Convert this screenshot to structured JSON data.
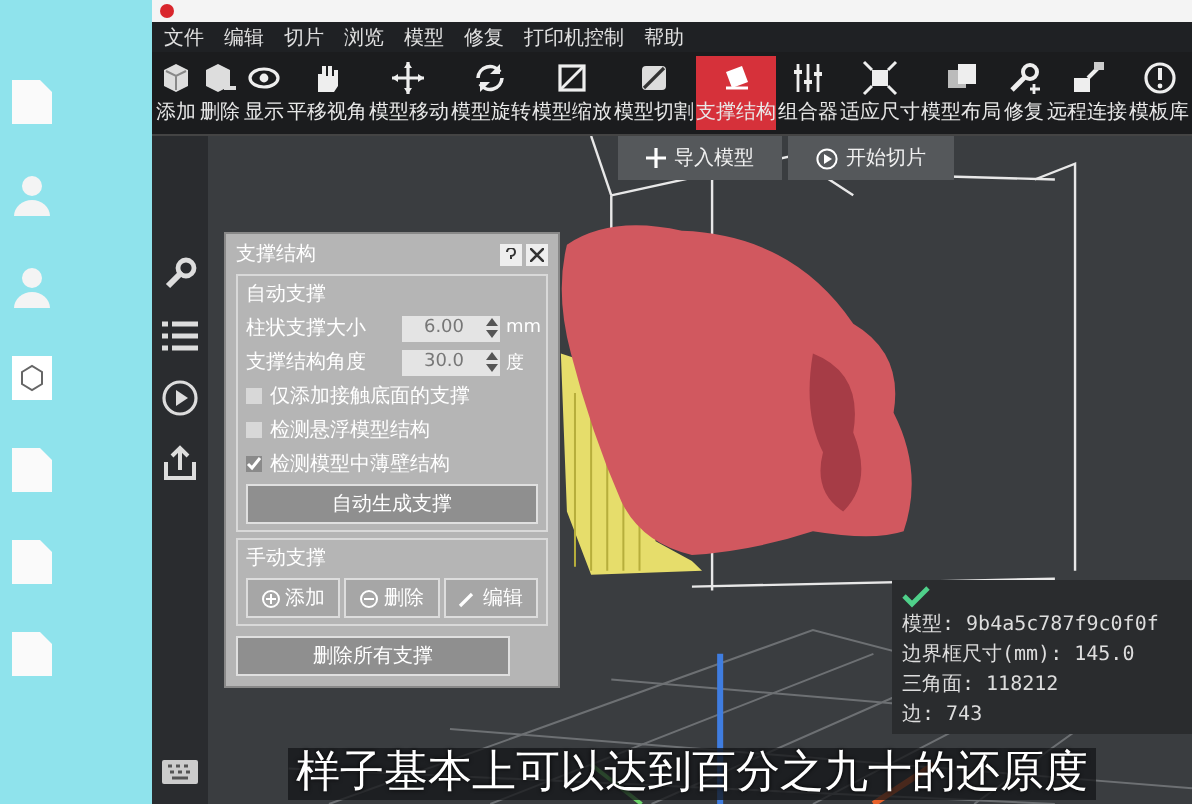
{
  "menu": [
    "文件",
    "编辑",
    "切片",
    "浏览",
    "模型",
    "修复",
    "打印机控制",
    "帮助"
  ],
  "toolbar": [
    {
      "label": "添加",
      "selected": false
    },
    {
      "label": "删除",
      "selected": false
    },
    {
      "label": "显示",
      "selected": false
    },
    {
      "label": "平移视角",
      "selected": false
    },
    {
      "label": "模型移动",
      "selected": false
    },
    {
      "label": "模型旋转",
      "selected": false
    },
    {
      "label": "模型缩放",
      "selected": false
    },
    {
      "label": "模型切割",
      "selected": false
    },
    {
      "label": "支撑结构",
      "selected": true
    },
    {
      "label": "组合器",
      "selected": false
    },
    {
      "label": "适应尺寸",
      "selected": false
    },
    {
      "label": "模型布局",
      "selected": false
    },
    {
      "label": "修复",
      "selected": false
    },
    {
      "label": "远程连接",
      "selected": false
    },
    {
      "label": "模板库",
      "selected": false
    }
  ],
  "viewport_buttons": [
    {
      "label": "导入模型"
    },
    {
      "label": "开始切片"
    }
  ],
  "support_panel": {
    "title": "支撑结构",
    "auto_section": {
      "title": "自动支撑",
      "fields": [
        {
          "label": "柱状支撑大小",
          "value": "6.00",
          "unit": "mm"
        },
        {
          "label": "支撑结构角度",
          "value": "30.0",
          "unit": "度"
        }
      ],
      "checkboxes": [
        {
          "label": "仅添加接触底面的支撑",
          "checked": false
        },
        {
          "label": "检测悬浮模型结构",
          "checked": false
        },
        {
          "label": "检测模型中薄壁结构",
          "checked": true
        }
      ],
      "button": "自动生成支撑"
    },
    "manual_section": {
      "title": "手动支撑",
      "buttons": [
        "添加",
        "删除",
        "编辑"
      ]
    },
    "footer_button": "删除所有支撑"
  },
  "model_info": {
    "lines": [
      "模型: 9b4a5c787f9c0f0f",
      "边界框尺寸(mm): 145.0",
      "三角面: 118212",
      "边: 743"
    ]
  },
  "subtitle": "样子基本上可以达到百分之九十的还原度"
}
